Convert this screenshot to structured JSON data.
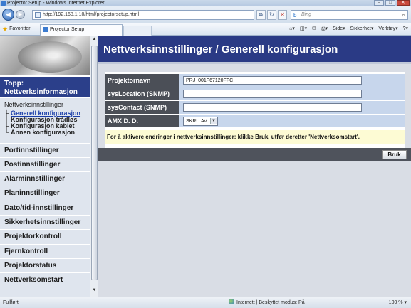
{
  "browser": {
    "window_title": "Projector Setup - Windows Internet Explorer",
    "url": "http://192.168.1.10/html/projectorsetup.html",
    "search_placeholder": "Bing",
    "favorites_label": "Favoritter",
    "tab_title": "Projector Setup",
    "tools": {
      "page": "Side",
      "safety": "Sikkerhet",
      "tools": "Verktøy"
    },
    "status": {
      "left": "Fullført",
      "zone": "Internett | Beskyttet modus: På",
      "zoom": "100 %"
    }
  },
  "sidebar": {
    "top_link": "Topp: Nettverksinformasjon",
    "section_title": "Nettverksinnstillinger",
    "sub_items": [
      "Generell konfigurasjon",
      "Konfigurasjon trådløs",
      "Konfigurasjon kablet",
      "Annen konfigurasjon"
    ],
    "menu": [
      "Portinnstillinger",
      "Postinnstillinger",
      "Alarminnstillinger",
      "Planinnstillinger",
      "Dato/tid-innstillinger",
      "Sikkerhetsinnstillinger",
      "Projektorkontroll",
      "Fjernkontroll",
      "Projektorstatus",
      "Nettverksomstart"
    ]
  },
  "main": {
    "title": "Nettverksinnstillinger / Generell konfigurasjon",
    "fields": {
      "projector_name": {
        "label": "Projektornavn",
        "value": "PRJ_001F67120FFC"
      },
      "sys_location": {
        "label": "sysLocation (SNMP)",
        "value": ""
      },
      "sys_contact": {
        "label": "sysContact (SNMP)",
        "value": ""
      },
      "amx": {
        "label": "AMX D. D.",
        "value": "SKRU AV"
      }
    },
    "notice": "For å aktivere endringer i nettverksinnstillinger: klikke Bruk, utfør deretter 'Nettverksomstart'.",
    "apply_label": "Bruk"
  }
}
